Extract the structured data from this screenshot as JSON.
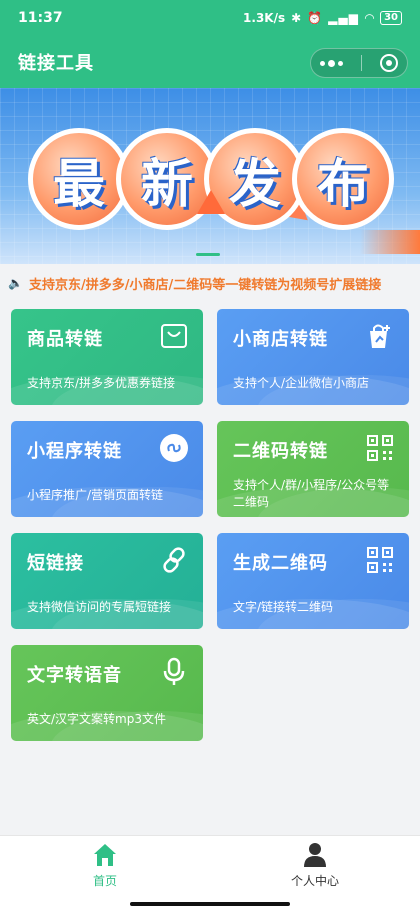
{
  "status_bar": {
    "time": "11:37",
    "network_speed": "1.3K/s",
    "battery": "30"
  },
  "nav": {
    "title": "链接工具"
  },
  "banner": {
    "chars": [
      "最",
      "新",
      "发",
      "布"
    ],
    "alt": "最新发布"
  },
  "notice": {
    "text": "支持京东/拼多多/小商店/二维码等一键转链为视频号扩展链接"
  },
  "cards": [
    {
      "title": "商品转链",
      "desc": "支持京东/拼多多优惠券链接",
      "icon": "shopping-bag-icon",
      "color": "#36c48a"
    },
    {
      "title": "小商店转链",
      "desc": "支持个人/企业微信小商店",
      "icon": "store-bag-plus-icon",
      "color": "#5a9ef3"
    },
    {
      "title": "小程序转链",
      "desc": "小程序推广/营销页面转链",
      "icon": "mini-program-icon",
      "color": "#5a9ef3"
    },
    {
      "title": "二维码转链",
      "desc": "支持个人/群/小程序/公众号等二维码",
      "icon": "qr-code-icon",
      "color": "#66c55a"
    },
    {
      "title": "短链接",
      "desc": "支持微信访问的专属短链接",
      "icon": "link-chain-icon",
      "color": "#2cbfa0"
    },
    {
      "title": "生成二维码",
      "desc": "文字/链接转二维码",
      "icon": "qr-code-icon",
      "color": "#5a9ef3"
    },
    {
      "title": "文字转语音",
      "desc": "英文/汉字文案转mp3文件",
      "icon": "microphone-icon",
      "color": "#66c55a"
    }
  ],
  "tabbar": {
    "home_label": "首页",
    "profile_label": "个人中心",
    "active_color": "#2fbf86"
  }
}
